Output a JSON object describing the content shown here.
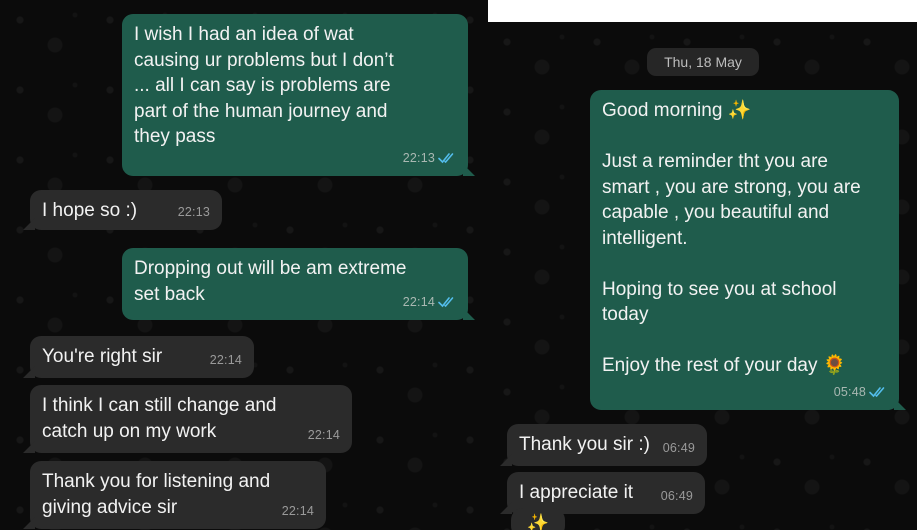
{
  "left_chat": {
    "messages": [
      {
        "text": "I wish I had an idea of wat\ncausing ur problems but I don’t\n... all I can say is problems are\npart of the human journey and\nthey pass",
        "time": "22:13"
      },
      {
        "text": "I hope so :)",
        "time": "22:13"
      },
      {
        "text": "Dropping out will be am extreme\nset back",
        "time": "22:14"
      },
      {
        "text": "You're right sir",
        "time": "22:14"
      },
      {
        "text": "I think I can still change and\ncatch up on my work",
        "time": "22:14"
      },
      {
        "text": "Thank you for listening and\ngiving advice sir",
        "time": "22:14"
      }
    ]
  },
  "right_chat": {
    "date": "Thu, 18 May",
    "messages": [
      {
        "text": "Good morning ✨\n\nJust a reminder tht you are\nsmart , you are strong, you are\ncapable , you beautiful and\nintelligent.\n\nHoping to see you at school\ntoday\n\nEnjoy the rest of your day 🌻",
        "time": "05:48"
      },
      {
        "text": "Thank you sir :)",
        "time": "06:49"
      },
      {
        "text": "I appreciate it",
        "time": "06:49"
      }
    ],
    "partial_emoji": "✨"
  },
  "colors": {
    "background": "#0b0b0b",
    "outgoing_bubble": "#1f5c4c",
    "incoming_bubble": "#2b2b2b",
    "read_ticks": "#53bdeb"
  },
  "icons": {
    "read_receipt": "double-check-icon"
  }
}
